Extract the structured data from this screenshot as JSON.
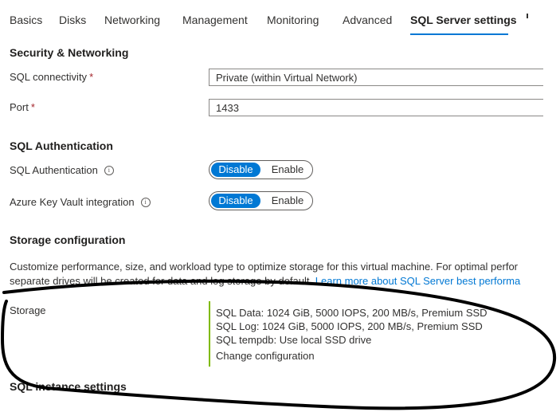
{
  "tabs": [
    {
      "label": "Basics"
    },
    {
      "label": "Disks"
    },
    {
      "label": "Networking"
    },
    {
      "label": "Management"
    },
    {
      "label": "Monitoring"
    },
    {
      "label": "Advanced"
    },
    {
      "label": "SQL Server settings",
      "active": true
    }
  ],
  "security": {
    "title": "Security & Networking",
    "connectivity_label": "SQL connectivity",
    "connectivity_value": "Private (within Virtual Network)",
    "port_label": "Port",
    "port_value": "1433",
    "required_marker": "*"
  },
  "auth": {
    "title": "SQL Authentication",
    "sql_auth_label": "SQL Authentication",
    "keyvault_label": "Azure Key Vault integration",
    "disable": "Disable",
    "enable": "Enable",
    "info_glyph": "i"
  },
  "storage": {
    "title": "Storage configuration",
    "desc_line1": "Customize performance, size, and workload type to optimize storage for this virtual machine. For optimal perfor",
    "desc_line2": "separate drives will be created for data and log storage by default.",
    "learn_more": "Learn more about SQL Server best performa",
    "storage_label": "Storage",
    "lines": [
      "SQL Data: 1024 GiB, 5000 IOPS, 200 MB/s, Premium SSD",
      "SQL Log: 1024 GiB, 5000 IOPS, 200 MB/s, Premium SSD",
      "SQL tempdb: Use local SSD drive"
    ],
    "change_config": "Change configuration"
  },
  "instance": {
    "title": "SQL instance settings"
  },
  "colors": {
    "accent": "#0078d4",
    "storage_bar": "#7fba00",
    "annotation": "#000000"
  }
}
